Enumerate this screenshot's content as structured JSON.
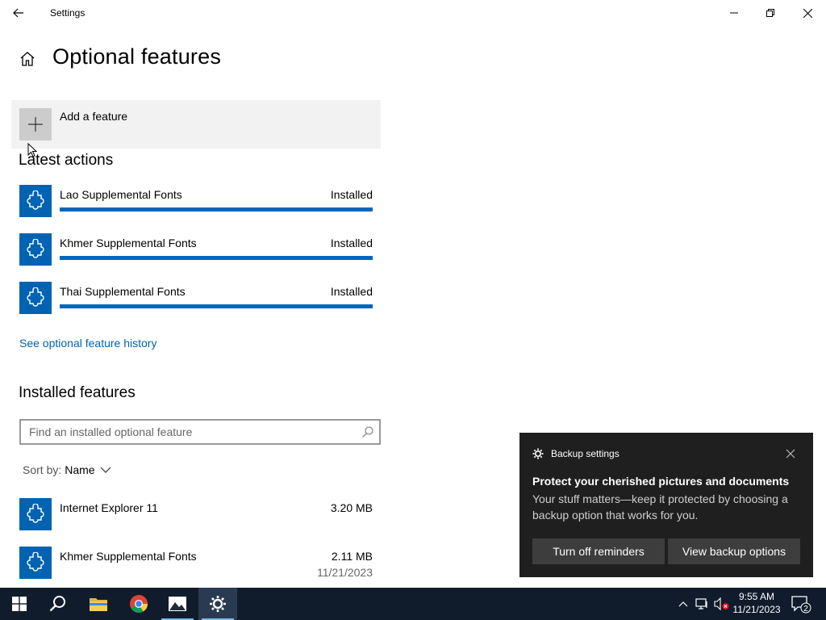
{
  "window": {
    "title": "Settings"
  },
  "header": {
    "title": "Optional features"
  },
  "add_feature": {
    "label": "Add a feature"
  },
  "latest_actions": {
    "title": "Latest actions",
    "items": [
      {
        "name": "Lao Supplemental Fonts",
        "status": "Installed",
        "progress": 1.0
      },
      {
        "name": "Khmer Supplemental Fonts",
        "status": "Installed",
        "progress": 1.0
      },
      {
        "name": "Thai Supplemental Fonts",
        "status": "Installed",
        "progress": 1.0
      }
    ]
  },
  "history_link": "See optional feature history",
  "installed": {
    "title": "Installed features",
    "search_placeholder": "Find an installed optional feature",
    "sort_label": "Sort by:",
    "sort_value": "Name",
    "items": [
      {
        "name": "Internet Explorer 11",
        "size": "3.20 MB",
        "date": ""
      },
      {
        "name": "Khmer Supplemental Fonts",
        "size": "2.11 MB",
        "date": "11/21/2023"
      }
    ]
  },
  "toast": {
    "app": "Backup settings",
    "title": "Protect your cherished pictures and documents",
    "body": "Your stuff matters—keep it protected by choosing a backup option that works for you.",
    "button1": "Turn off reminders",
    "button2": "View backup options"
  },
  "taskbar": {
    "time": "9:55 AM",
    "date": "11/21/2023",
    "notification_count": "2",
    "accent": "#0063b1"
  }
}
